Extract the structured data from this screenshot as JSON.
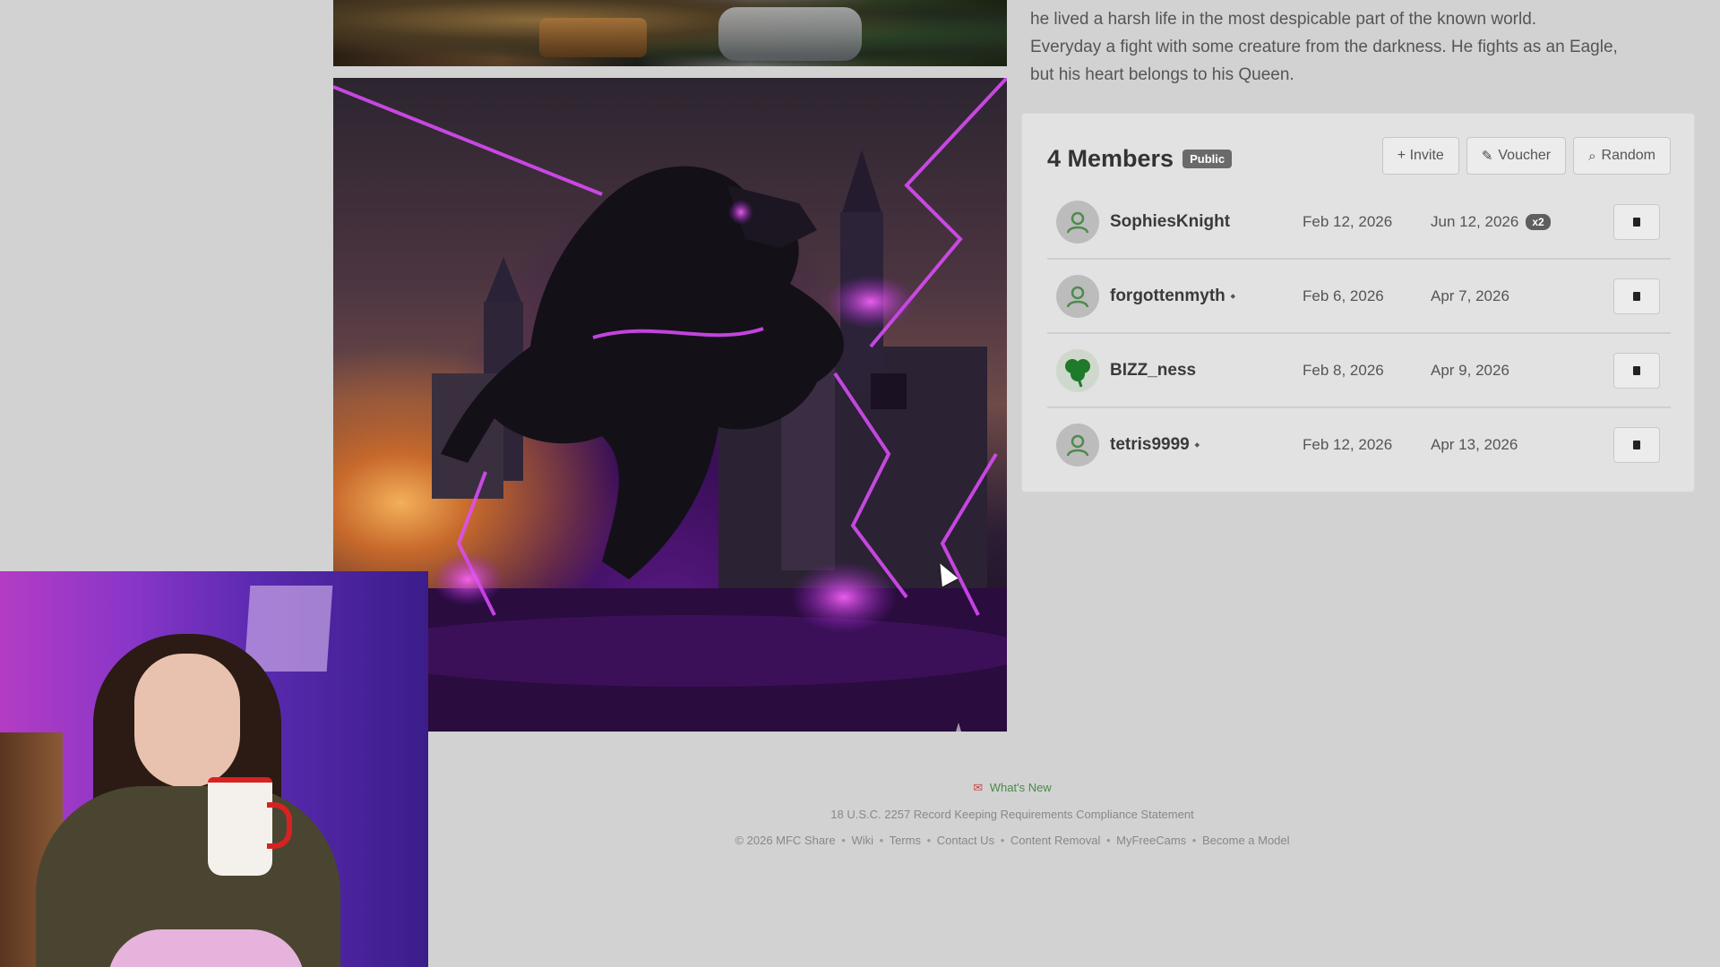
{
  "description": {
    "line1": "he lived a harsh life in the most despicable part of the known world.",
    "line2": "Everyday a fight with some creature from the darkness. He fights as an Eagle,",
    "line3": "but his heart belongs to his Queen."
  },
  "members": {
    "title": "4 Members",
    "visibility_badge": "Public",
    "buttons": {
      "invite": "+ Invite",
      "voucher": "Voucher",
      "random": "Random"
    },
    "list": [
      {
        "name": "SophiesKnight",
        "joined": "Feb 12, 2026",
        "expires": "Jun 12, 2026",
        "multiplier": "x2",
        "tagged": false,
        "avatar": "user-icon"
      },
      {
        "name": "forgottenmyth",
        "joined": "Feb 6, 2026",
        "expires": "Apr 7, 2026",
        "multiplier": "",
        "tagged": true,
        "avatar": "user-icon"
      },
      {
        "name": "BIZZ_ness",
        "joined": "Feb 8, 2026",
        "expires": "Apr 9, 2026",
        "multiplier": "",
        "tagged": false,
        "avatar": "clover-icon"
      },
      {
        "name": "tetris9999",
        "joined": "Feb 12, 2026",
        "expires": "Apr 13, 2026",
        "multiplier": "",
        "tagged": true,
        "avatar": "user-icon"
      }
    ]
  },
  "footer": {
    "whats_new": "What's New",
    "compliance": "18 U.S.C. 2257 Record Keeping Requirements Compliance Statement",
    "copyright": "© 2026 MFC Share",
    "links": [
      "Wiki",
      "Terms",
      "Contact Us",
      "Content Removal",
      "MyFreeCams",
      "Become a Model"
    ]
  },
  "colors": {
    "page_bg": "#d2d2d2",
    "panel_bg": "#e2e2e2",
    "accent_green": "#4a8a4a",
    "badge_grey": "#6a6a6a"
  }
}
